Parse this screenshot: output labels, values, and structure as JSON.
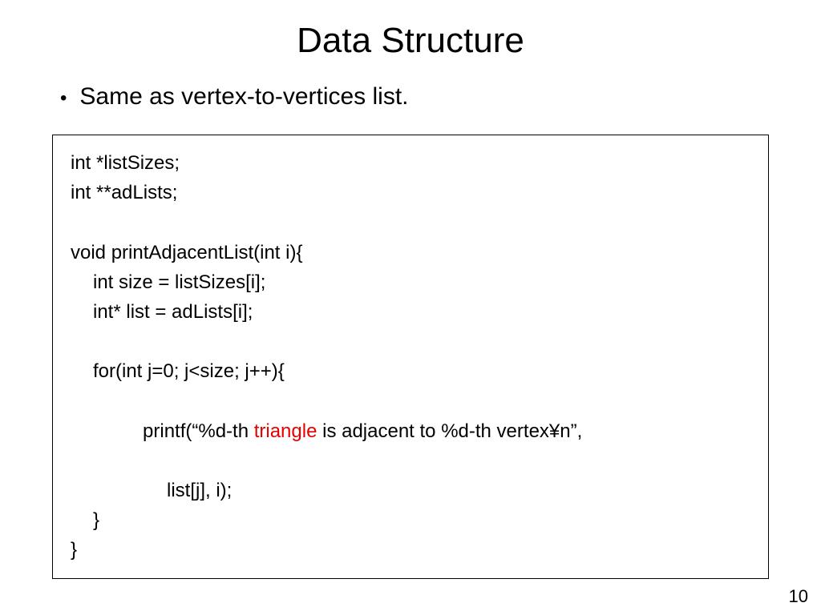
{
  "title": "Data Structure",
  "bullet": "Same as vertex-to-vertices list.",
  "code": {
    "l1": "int *listSizes;",
    "l2": "int **adLists;",
    "l3": "void printAdjacentList(int i){",
    "l4": "int size = listSizes[i];",
    "l5": "int* list = adLists[i];",
    "l6": "for(int j=0; j<size; j++){",
    "l7a": "printf(“%d-th ",
    "l7b": "triangle",
    "l7c": " is adjacent to %d-th vertex¥n”,",
    "l8": "list[j], i);",
    "l9": "}",
    "l10": "}"
  },
  "page_number": "10"
}
